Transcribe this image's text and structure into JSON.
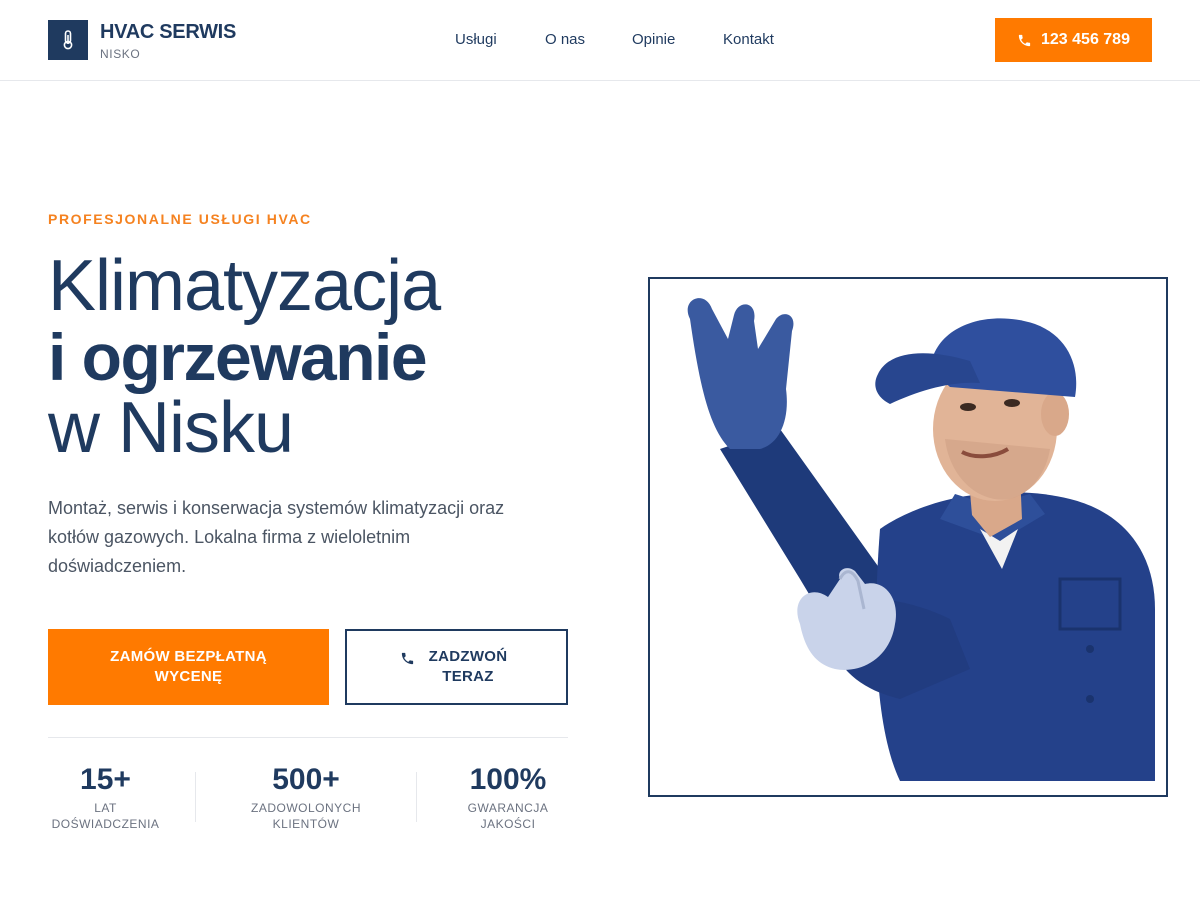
{
  "header": {
    "brand_name": "HVAC SERWIS",
    "brand_sub": "NISKO",
    "logo_icon": "thermometer-icon",
    "nav": [
      "Usługi",
      "O nas",
      "Opinie",
      "Kontakt"
    ],
    "phone_label": "123 456 789",
    "accent_color": "#ff7a00",
    "brand_color": "#1f3a5f"
  },
  "hero": {
    "eyebrow": "PROFESJONALNE USŁUGI HVAC",
    "title_line1": "Klimatyzacja",
    "title_line2": "i ogrzewanie",
    "title_line3": "w Nisku",
    "description": "Montaż, serwis i konserwacja systemów klimatyzacji oraz kotłów gazowych. Lokalna firma z wieloletnim doświadczeniem.",
    "cta_primary": "ZAMÓW BEZPŁATNĄ WYCENĘ",
    "cta_secondary": "ZADZWOŃ TERAZ"
  },
  "stats": [
    {
      "value": "15+",
      "label": "LAT DOŚWIADCZENIA"
    },
    {
      "value": "500+",
      "label": "ZADOWOLONYCH KLIENTÓW"
    },
    {
      "value": "100%",
      "label": "GWARANCJA JAKOŚCI"
    }
  ]
}
